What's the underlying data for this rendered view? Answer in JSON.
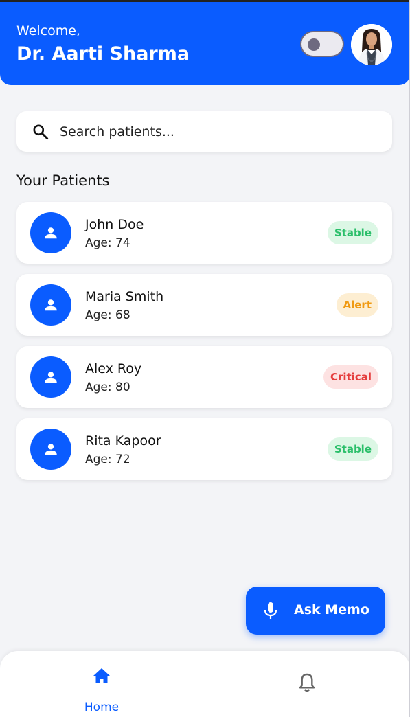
{
  "header": {
    "greeting": "Welcome,",
    "doctor_name": "Dr. Aarti Sharma",
    "theme_toggle_on": false
  },
  "search": {
    "placeholder": "Search patients..."
  },
  "patients_section": {
    "title": "Your Patients"
  },
  "patients": [
    {
      "name": "John Doe",
      "age": "Age: 74",
      "status": "Stable",
      "status_bg": "#dcf7e5",
      "status_color": "#2bbf6a"
    },
    {
      "name": "Maria Smith",
      "age": "Age: 68",
      "status": "Alert",
      "status_bg": "#fdeed2",
      "status_color": "#f09a12"
    },
    {
      "name": "Alex Roy",
      "age": "Age: 80",
      "status": "Critical",
      "status_bg": "#fde2e2",
      "status_color": "#e53c3c"
    },
    {
      "name": "Rita Kapoor",
      "age": "Age: 72",
      "status": "Stable",
      "status_bg": "#dcf7e5",
      "status_color": "#2bbf6a"
    }
  ],
  "fab": {
    "label": "Ask Memo",
    "icon": "microphone-icon"
  },
  "bottom_nav": {
    "home_label": "Home",
    "home_icon": "home-icon",
    "notifications_icon": "bell-icon"
  },
  "colors": {
    "primary": "#0a5cff",
    "background": "#f3f4f7"
  }
}
